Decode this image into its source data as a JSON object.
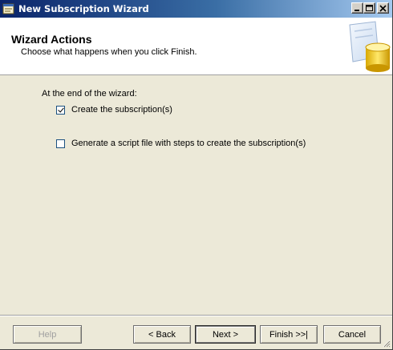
{
  "window": {
    "title": "New Subscription Wizard"
  },
  "header": {
    "title": "Wizard Actions",
    "subtitle": "Choose what happens when you click Finish."
  },
  "content": {
    "section_label": "At the end of the wizard:",
    "options": [
      {
        "label": "Create the subscription(s)",
        "checked": true
      },
      {
        "label": "Generate a script file with steps to create the subscription(s)",
        "checked": false
      }
    ]
  },
  "buttons": {
    "help": "Help",
    "back": "< Back",
    "next": "Next >",
    "finish": "Finish >>|",
    "cancel": "Cancel"
  },
  "icons": [
    "wizard-app-icon",
    "minimize-icon",
    "maximize-icon",
    "close-icon",
    "database-wizard-graphic",
    "size-grip-icon"
  ],
  "colors": {
    "titlebar_start": "#0a246a",
    "titlebar_end": "#a6caf0",
    "dialog_bg": "#ece9d8",
    "header_bg": "#ffffff"
  }
}
